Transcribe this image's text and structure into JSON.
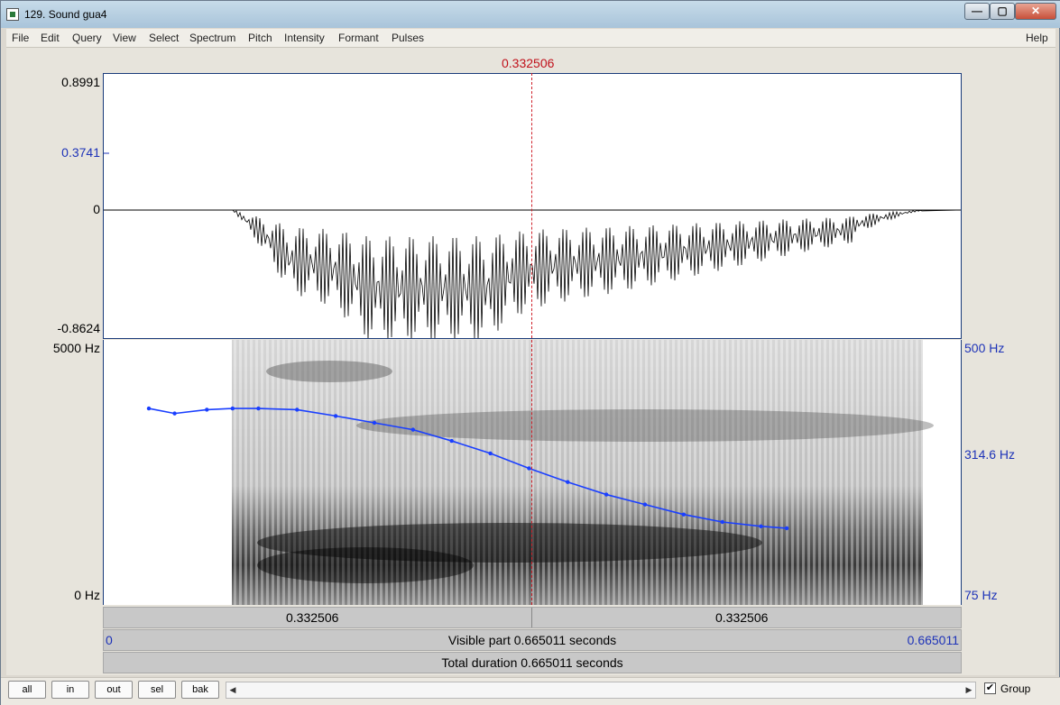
{
  "window": {
    "title": "129. Sound gua4",
    "controls": {
      "minimize": "—",
      "maximize": "▢",
      "close": "✕"
    }
  },
  "menu": [
    "File",
    "Edit",
    "Query",
    "View",
    "Select",
    "Spectrum",
    "Pitch",
    "Intensity",
    "Formant",
    "Pulses",
    "Help"
  ],
  "cursor_time": "0.332506",
  "waveform": {
    "y_max": "0.8991",
    "y_mark": "0.3741",
    "y_zero": "0",
    "y_min": "-0.8624"
  },
  "spectrogram": {
    "freq_top": "5000 Hz",
    "freq_bottom": "0 Hz",
    "pitch_top": "500 Hz",
    "pitch_mid": "314.6 Hz",
    "pitch_bottom": "75 Hz"
  },
  "time_bars": {
    "left_segment": "0.332506",
    "right_segment": "0.332506",
    "visible_start": "0",
    "visible_label": "Visible part 0.665011 seconds",
    "visible_end": "0.665011",
    "total_label": "Total duration 0.665011 seconds"
  },
  "buttons": {
    "all": "all",
    "in": "in",
    "out": "out",
    "sel": "sel",
    "bak": "bak"
  },
  "group": {
    "label": "Group",
    "checked": "✔"
  },
  "colors": {
    "cursor": "#c0101a",
    "axis_blue": "#1e33b8",
    "pitch_line": "#1a3fff"
  },
  "chart_data": {
    "type": "line",
    "ylabel": "Hz",
    "ylim": [
      75,
      500
    ],
    "series": [
      {
        "x": [
          0.035,
          0.055,
          0.08,
          0.1,
          0.12,
          0.15,
          0.18,
          0.21,
          0.24,
          0.27,
          0.3,
          0.33,
          0.36,
          0.39,
          0.42,
          0.45,
          0.48,
          0.51,
          0.53
        ],
        "values": [
          390,
          382,
          388,
          390,
          390,
          388,
          378,
          367,
          356,
          338,
          318,
          294,
          272,
          252,
          236,
          220,
          208,
          201,
          198
        ]
      }
    ]
  }
}
